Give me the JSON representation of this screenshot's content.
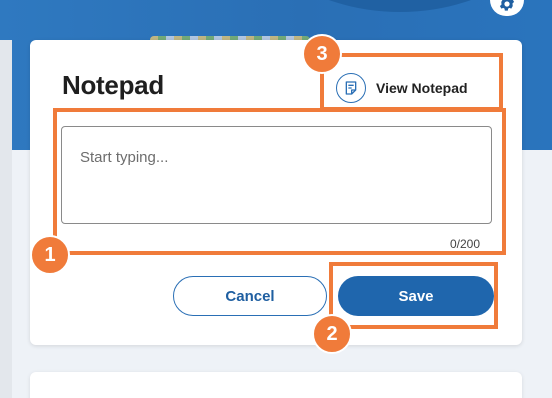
{
  "notepad": {
    "title": "Notepad",
    "view_label": "View Notepad",
    "placeholder": "Start typing...",
    "char_count": "0/200",
    "cancel_label": "Cancel",
    "save_label": "Save"
  },
  "callouts": [
    "1",
    "2",
    "3"
  ],
  "colors": {
    "brand_blue": "#1f66ad",
    "callout_orange": "#f07b3a"
  },
  "icons": {
    "settings": "gear-icon",
    "view_notepad": "note-icon"
  }
}
